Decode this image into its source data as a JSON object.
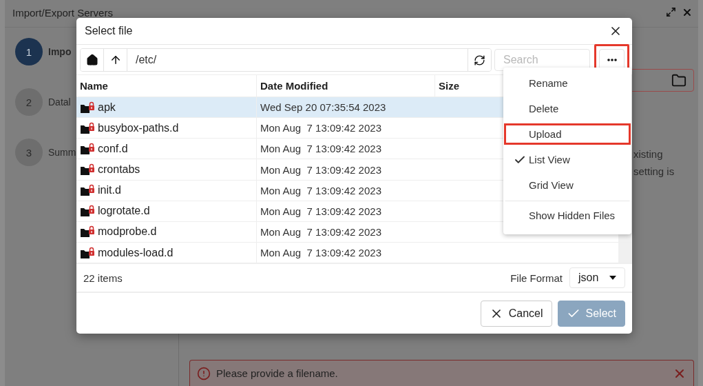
{
  "background_window": {
    "title": "Import/Export Servers",
    "steps": [
      {
        "number": "1",
        "label": "Impo",
        "selected": true
      },
      {
        "number": "2",
        "label": "Datal",
        "selected": false
      },
      {
        "number": "3",
        "label": "Summ",
        "selected": false
      }
    ],
    "file_field": {
      "invalid": true
    },
    "help_text": [
      "xisting",
      "setting is"
    ],
    "error": {
      "message": "Please provide a filename."
    }
  },
  "dialog": {
    "title": "Select file",
    "path": "/etc/",
    "search": {
      "placeholder": "Search"
    },
    "more_button": {
      "highlighted": true
    },
    "columns": [
      "Name",
      "Date Modified",
      "Size"
    ],
    "rows": [
      {
        "name": "apk",
        "modified": "Wed Sep 20 07:35:54 2023",
        "selected": true
      },
      {
        "name": "busybox-paths.d",
        "modified": "Mon Aug  7 13:09:42 2023",
        "selected": false
      },
      {
        "name": "conf.d",
        "modified": "Mon Aug  7 13:09:42 2023",
        "selected": false
      },
      {
        "name": "crontabs",
        "modified": "Mon Aug  7 13:09:42 2023",
        "selected": false
      },
      {
        "name": "init.d",
        "modified": "Mon Aug  7 13:09:42 2023",
        "selected": false
      },
      {
        "name": "logrotate.d",
        "modified": "Mon Aug  7 13:09:42 2023",
        "selected": false
      },
      {
        "name": "modprobe.d",
        "modified": "Mon Aug  7 13:09:42 2023",
        "selected": false
      },
      {
        "name": "modules-load.d",
        "modified": "Mon Aug  7 13:09:42 2023",
        "selected": false
      }
    ],
    "item_count": "22 items",
    "file_format": {
      "label": "File Format",
      "value": "json"
    },
    "buttons": [
      {
        "kind": "cancel",
        "label": "Cancel",
        "disabled": false
      },
      {
        "kind": "select",
        "label": "Select",
        "disabled": true
      }
    ]
  },
  "menu": {
    "items": [
      {
        "label": "Rename",
        "checked": false,
        "highlighted": false,
        "separated": false
      },
      {
        "label": "Delete",
        "checked": false,
        "highlighted": false,
        "separated": false
      },
      {
        "label": "Upload",
        "checked": false,
        "highlighted": true,
        "separated": false
      },
      {
        "label": "List View",
        "checked": true,
        "highlighted": false,
        "separated": false
      },
      {
        "label": "Grid View",
        "checked": false,
        "highlighted": false,
        "separated": false
      },
      {
        "label": "Show Hidden Files",
        "checked": false,
        "highlighted": false,
        "separated": true
      }
    ]
  }
}
